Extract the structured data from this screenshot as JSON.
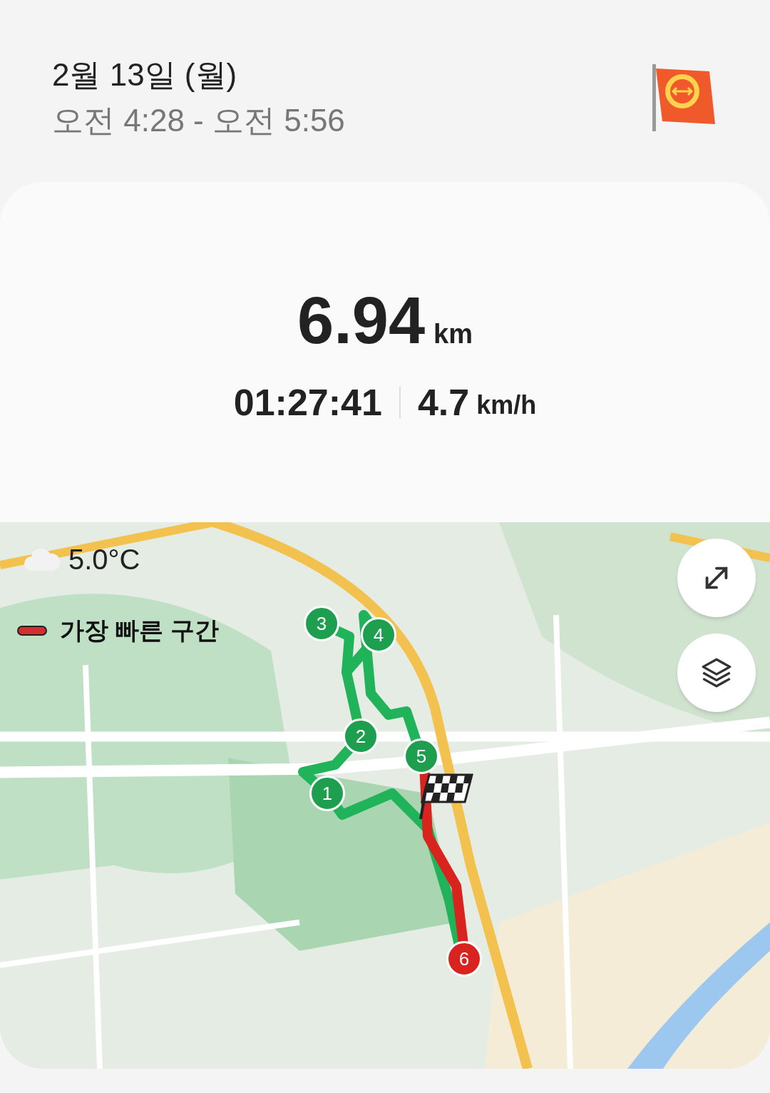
{
  "header": {
    "date": "2월 13일 (월)",
    "time_range": "오전 4:28 - 오전 5:56"
  },
  "summary": {
    "distance": "6.94",
    "distance_unit": "km",
    "duration": "01:27:41",
    "speed": "4.7",
    "speed_unit": "km/h"
  },
  "map": {
    "weather": {
      "temperature": "5.0°C"
    },
    "legend": {
      "label": "가장 빠른 구간",
      "color": "#d32f2f"
    },
    "markers": [
      {
        "label": "1",
        "color": "#1e9e4f"
      },
      {
        "label": "2",
        "color": "#1e9e4f"
      },
      {
        "label": "3",
        "color": "#1e9e4f"
      },
      {
        "label": "4",
        "color": "#1e9e4f"
      },
      {
        "label": "5",
        "color": "#1e9e4f"
      },
      {
        "label": "6",
        "color": "#d8231f"
      }
    ],
    "buttons": [
      {
        "kind": "expand"
      },
      {
        "kind": "layers"
      }
    ]
  }
}
